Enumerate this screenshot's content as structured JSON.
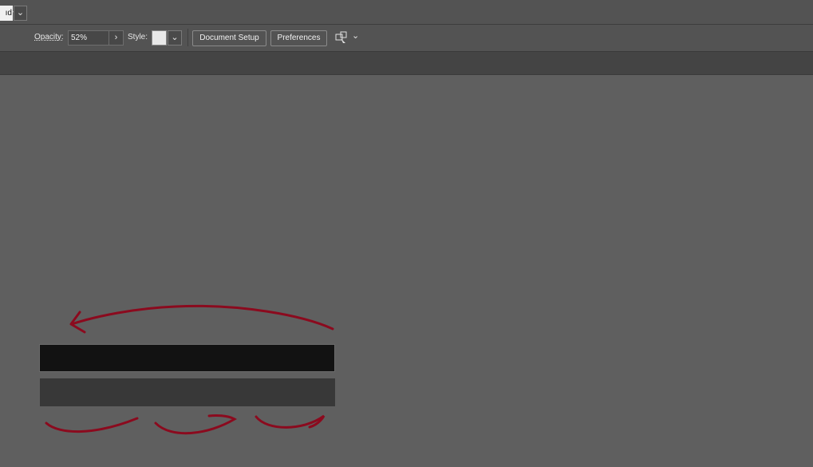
{
  "topbar": {
    "workspace_switcher_icon": "grid-icon",
    "workspace_chevron": "⌄"
  },
  "controlbar": {
    "blend_mode_value": "ıd",
    "opacity_label": "Opacity:",
    "opacity_value": "52%",
    "opacity_arrow": "›",
    "style_label": "Style:",
    "document_setup_label": "Document Setup",
    "preferences_label": "Preferences",
    "arrange_icon": "arrange-documents-icon",
    "chevron": "⌄"
  },
  "canvas": {
    "annotation_color": "#8b0a1e",
    "dark_rect_color": "#121212",
    "mid_rect_color": "#383838"
  }
}
